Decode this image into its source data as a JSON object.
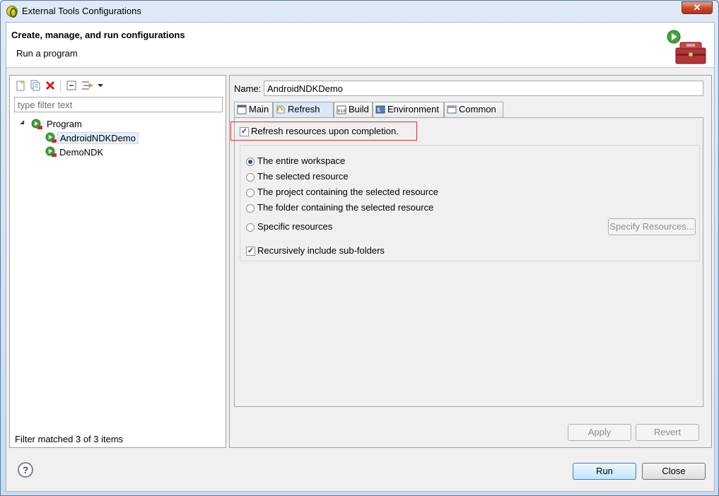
{
  "window": {
    "title": "External Tools Configurations",
    "close_glyph": "✕"
  },
  "header": {
    "title": "Create, manage, and run configurations",
    "subtitle": "Run a program"
  },
  "left": {
    "toolbar": [
      "new-launch-config-icon",
      "duplicate-icon",
      "delete-icon",
      "collapse-all-icon",
      "filter-icon",
      "view-menu-icon"
    ],
    "filter_placeholder": "type filter text",
    "tree": {
      "root": "Program",
      "children": [
        "AndroidNDKDemo",
        "DemoNDK"
      ],
      "selected": "AndroidNDKDemo"
    },
    "status": "Filter matched 3 of 3 items"
  },
  "right": {
    "name_label": "Name:",
    "name_value": "AndroidNDKDemo",
    "tabs": [
      {
        "label": "Main",
        "icon": "main-tab-icon"
      },
      {
        "label": "Refresh",
        "icon": "refresh-icon",
        "active": true
      },
      {
        "label": "Build",
        "icon": "build-icon"
      },
      {
        "label": "Environment",
        "icon": "environment-icon"
      },
      {
        "label": "Common",
        "icon": "common-icon"
      }
    ],
    "refresh_checkbox": {
      "label": "Refresh resources upon completion.",
      "checked": true
    },
    "radios": [
      {
        "label": "The entire workspace",
        "checked": true
      },
      {
        "label": "The selected resource",
        "checked": false
      },
      {
        "label": "The project containing the selected resource",
        "checked": false
      },
      {
        "label": "The folder containing the selected resource",
        "checked": false
      },
      {
        "label": "Specific resources",
        "checked": false
      }
    ],
    "specify_button": "Specify Resources...",
    "recursive_checkbox": {
      "label": "Recursively include sub-folders",
      "checked": true
    },
    "apply_button": "Apply",
    "revert_button": "Revert"
  },
  "footer": {
    "help_glyph": "?",
    "run_button": "Run",
    "close_button": "Close"
  },
  "colors": {
    "selection": "#e5eef8",
    "highlight_border": "#e03030",
    "check": "#1e3f72"
  }
}
